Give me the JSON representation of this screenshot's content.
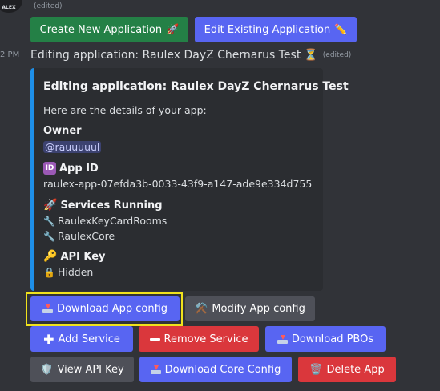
{
  "top": {
    "edited_label": "(edited)",
    "avatar_label": "ALEX",
    "timestamp": "2 PM"
  },
  "buttons_top": {
    "create": "Create New Application",
    "edit": "Edit Existing Application"
  },
  "message": {
    "text": "Editing application: Raulex DayZ Chernarus Test",
    "edited": "(edited)"
  },
  "embed": {
    "title": "Editing application: Raulex DayZ Chernarus Test",
    "description": "Here are the details of your app:",
    "owner_label": "Owner",
    "owner_value": "@rauuuuul",
    "app_id_label": "App ID",
    "app_id_badge": "ID",
    "app_id_value": "raulex-app-07efda3b-0033-43f9-a147-ade9e334d755",
    "services_label": "Services Running",
    "services": [
      "RaulexKeyCardRooms",
      "RaulexCore"
    ],
    "api_key_label": "API Key",
    "api_key_value": "Hidden"
  },
  "actions": {
    "download_app_config": "Download App config",
    "modify_app_config": "Modify App config",
    "add_service": "Add Service",
    "remove_service": "Remove Service",
    "download_pbos": "Download PBOs",
    "view_api_key": "View API Key",
    "download_core_config": "Download Core Config",
    "delete_app": "Delete App"
  },
  "colors": {
    "accent_bar": "#1e8fe8",
    "green": "#248046",
    "blurple": "#5865f2",
    "grey": "#4e5058",
    "red": "#da373c",
    "highlight": "#f0e21c"
  }
}
